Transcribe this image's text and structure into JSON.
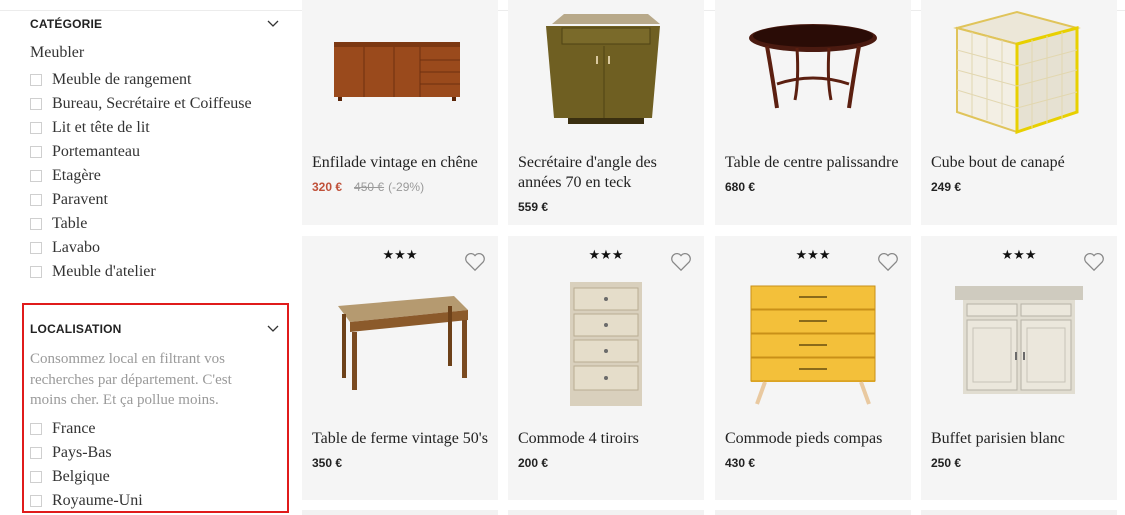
{
  "filters": {
    "category": {
      "title": "CATÉGORIE",
      "subcategory": "Meubler",
      "options": [
        "Meuble de rangement",
        "Bureau, Secrétaire et Coiffeuse",
        "Lit et tête de lit",
        "Portemanteau",
        "Etagère",
        "Paravent",
        "Table",
        "Lavabo",
        "Meuble d'atelier"
      ]
    },
    "location": {
      "title": "LOCALISATION",
      "description": "Consommez local en filtrant vos recherches par département. C'est moins cher. Et ça pollue moins.",
      "options": [
        "France",
        "Pays-Bas",
        "Belgique",
        "Royaume-Uni"
      ]
    }
  },
  "products": [
    {
      "title": "Enfilade vintage en chêne",
      "price": "320 €",
      "old_price": "450 €",
      "discount": "(-29%)",
      "on_sale": true
    },
    {
      "title": "Secrétaire d'angle des années 70 en teck",
      "price": "559 €"
    },
    {
      "title": "Table de centre palissandre",
      "price": "680 €"
    },
    {
      "title": "Cube bout de canapé",
      "price": "249 €"
    },
    {
      "title": "Table de ferme vintage 50's",
      "price": "350 €",
      "stars": "★★★"
    },
    {
      "title": "Commode 4 tiroirs",
      "price": "200 €",
      "stars": "★★★"
    },
    {
      "title": "Commode pieds compas",
      "price": "430 €",
      "stars": "★★★"
    },
    {
      "title": "Buffet parisien blanc",
      "price": "250 €",
      "stars": "★★★"
    }
  ],
  "icons": {
    "chevron": "chevron-down-icon",
    "heart": "heart-icon"
  },
  "colors": {
    "sale": "#c0513a",
    "highlight": "#e01b1b",
    "card_bg": "#f5f5f5"
  }
}
